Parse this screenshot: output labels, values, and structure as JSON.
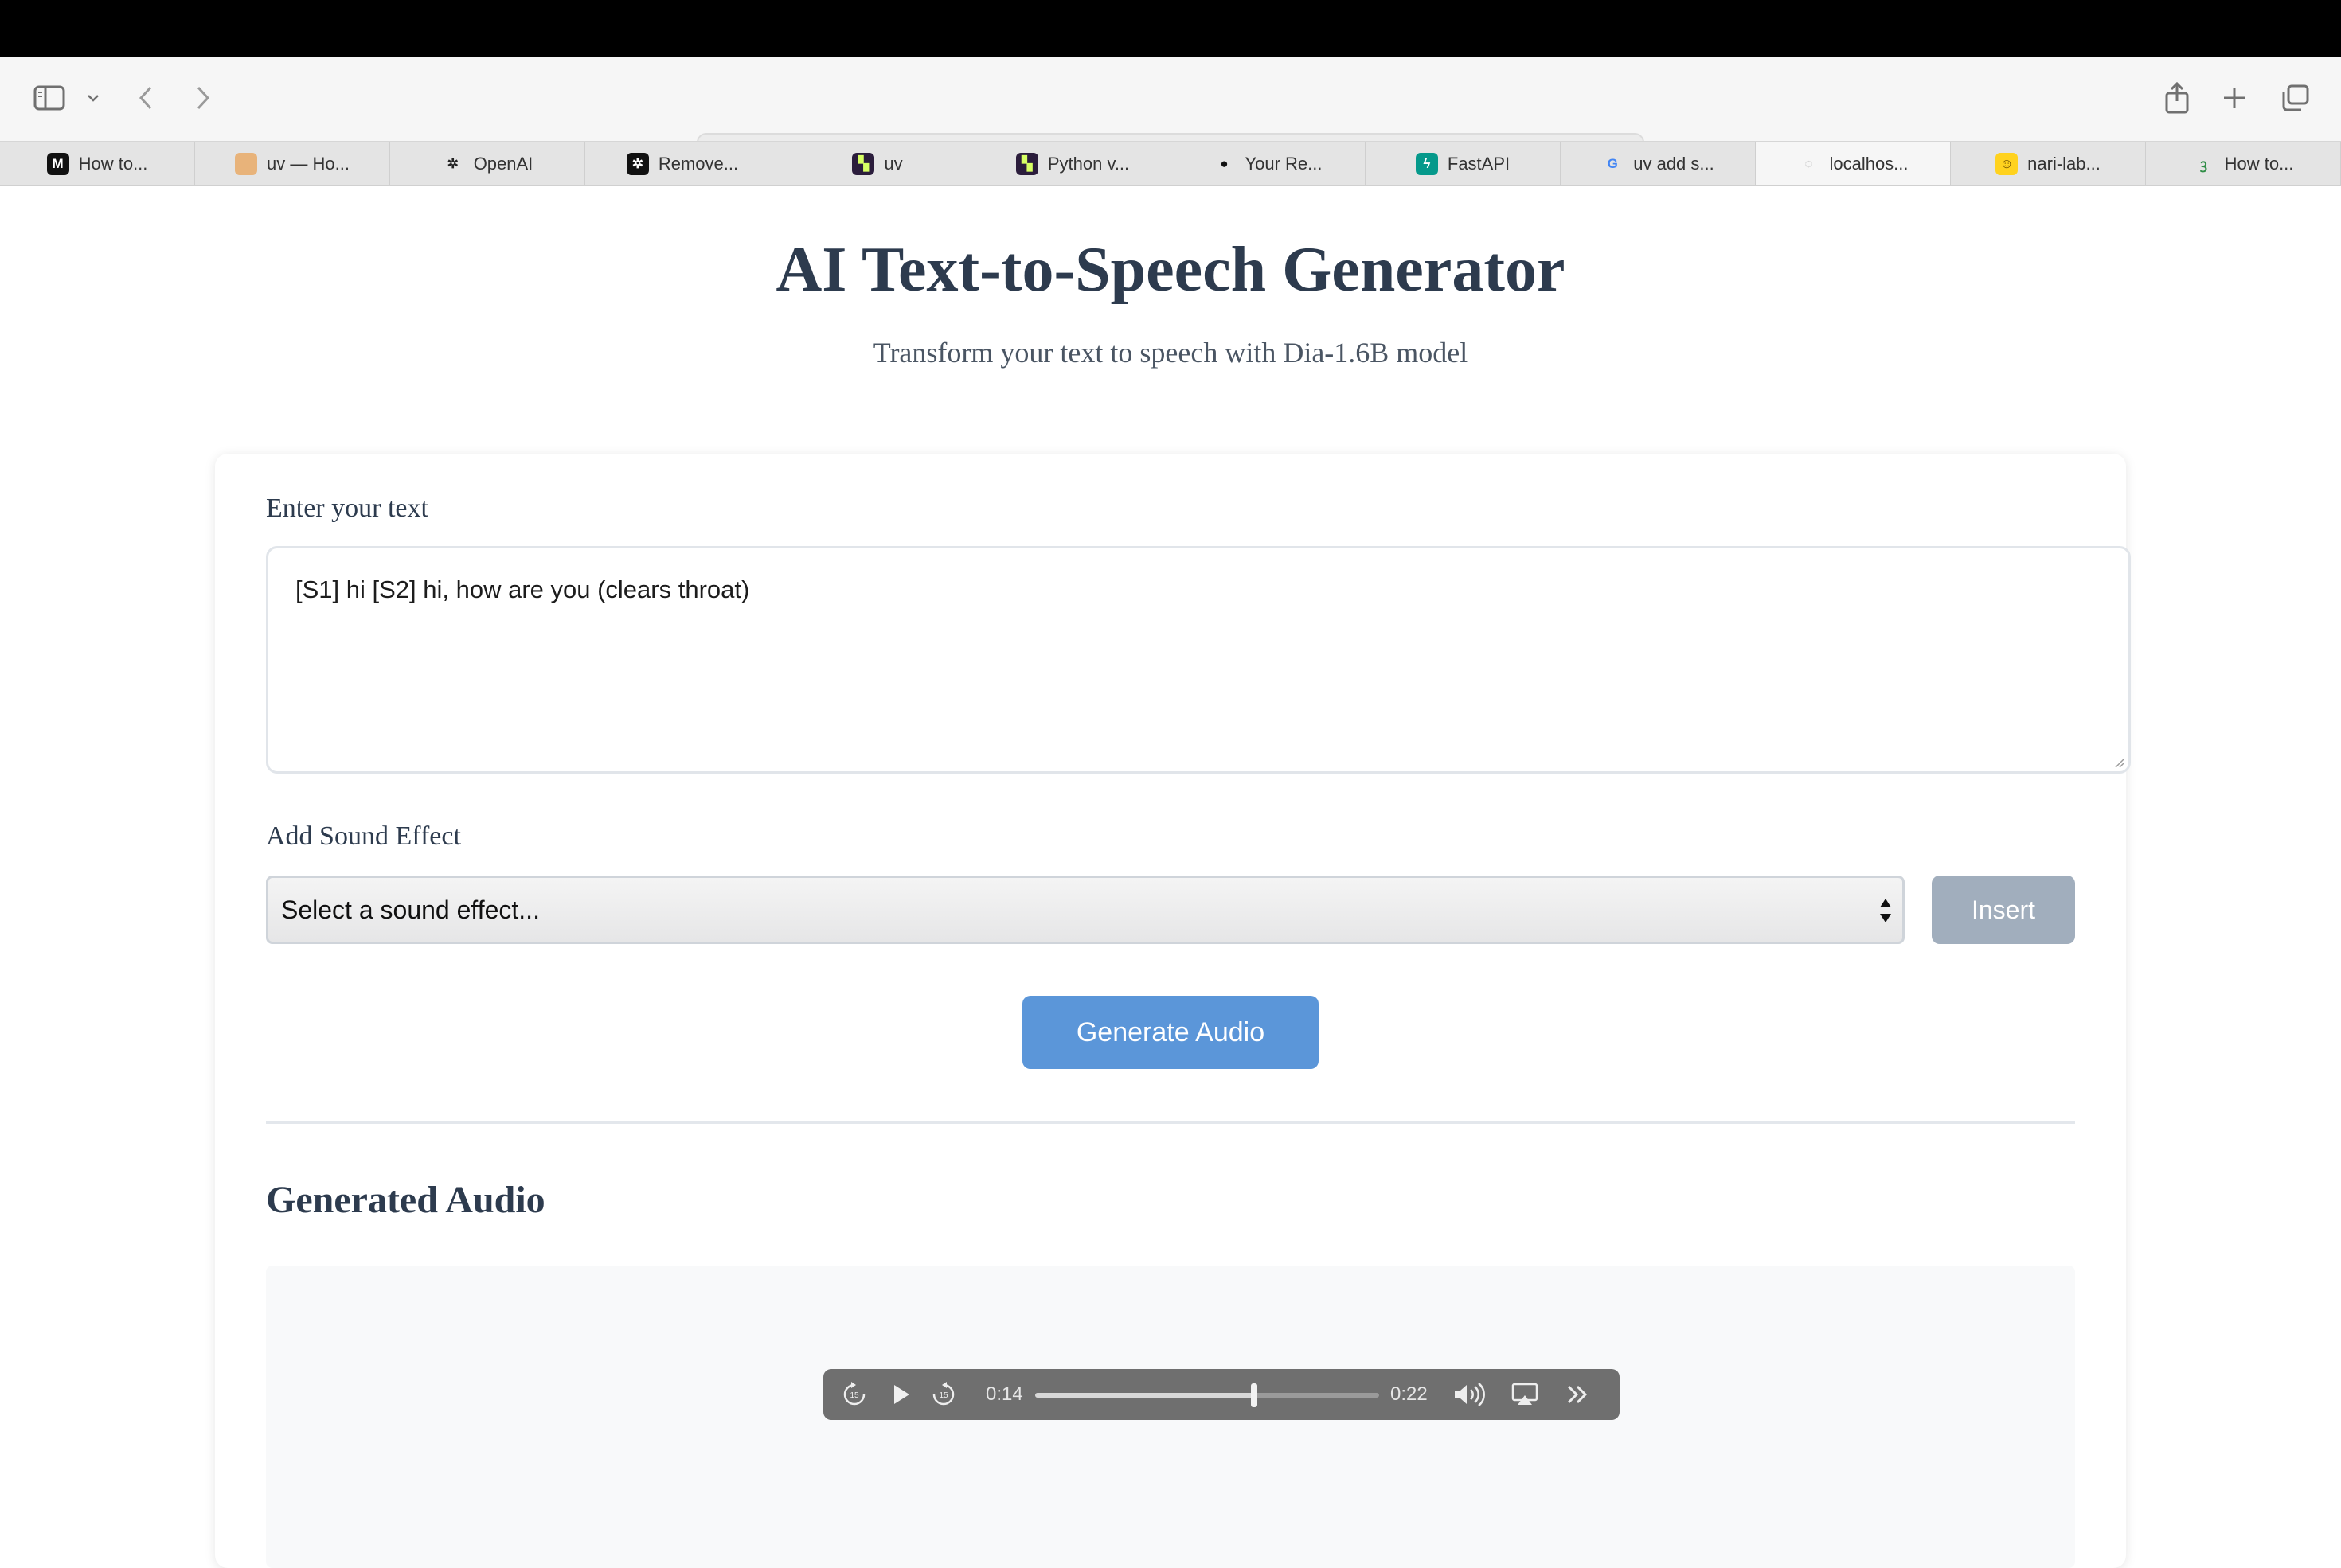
{
  "browser": {
    "url": "localhost",
    "tabs": [
      {
        "label": "How to...",
        "favicon": "medium-icon",
        "favicon_text": "M",
        "favicon_bg": "#111111",
        "favicon_fg": "#ffffff"
      },
      {
        "label": "uv — Ho...",
        "favicon": "jar-icon",
        "favicon_text": "",
        "favicon_bg": "#e8b37a",
        "favicon_fg": "#ffffff"
      },
      {
        "label": "OpenAI",
        "favicon": "openai-icon",
        "favicon_text": "✲",
        "favicon_bg": "#e4e4e4",
        "favicon_fg": "#222222"
      },
      {
        "label": "Remove...",
        "favicon": "openai-dark-icon",
        "favicon_text": "✲",
        "favicon_bg": "#111111",
        "favicon_fg": "#ffffff"
      },
      {
        "label": "uv",
        "favicon": "astral-icon",
        "favicon_text": "▚",
        "favicon_bg": "#2b1d3c",
        "favicon_fg": "#d7ff64"
      },
      {
        "label": "Python v...",
        "favicon": "astral-icon",
        "favicon_text": "▚",
        "favicon_bg": "#2b1d3c",
        "favicon_fg": "#d7ff64"
      },
      {
        "label": "Your Re...",
        "favicon": "github-icon",
        "favicon_text": "●",
        "favicon_bg": "#e4e4e4",
        "favicon_fg": "#111111"
      },
      {
        "label": "FastAPI",
        "favicon": "fastapi-icon",
        "favicon_text": "ϟ",
        "favicon_bg": "#05998b",
        "favicon_fg": "#ffffff"
      },
      {
        "label": "uv add s...",
        "favicon": "google-icon",
        "favicon_text": "G",
        "favicon_bg": "#e4e4e4",
        "favicon_fg": "#4285f4"
      },
      {
        "label": "localhos...",
        "favicon": "globe-icon",
        "favicon_text": "◌",
        "favicon_bg": "#f6f6f6",
        "favicon_fg": "#bbbbbb",
        "active": true
      },
      {
        "label": "nari-lab...",
        "favicon": "huggingface-icon",
        "favicon_text": "☺",
        "favicon_bg": "#ffd21e",
        "favicon_fg": "#6b4b00"
      },
      {
        "label": "How to...",
        "favicon": "geeksforgeeks-icon",
        "favicon_text": "ꝫ",
        "favicon_bg": "#e4e4e4",
        "favicon_fg": "#2f8d46"
      }
    ]
  },
  "page": {
    "title": "AI Text-to-Speech Generator",
    "subtitle": "Transform your text to speech with Dia-1.6B model"
  },
  "form": {
    "text_label": "Enter your text",
    "text_value": "[S1] hi [S2] hi, how are you (clears throat)",
    "sound_label": "Add Sound Effect",
    "sound_selected": "Select a sound effect...",
    "insert_label": "Insert",
    "generate_label": "Generate Audio"
  },
  "output": {
    "heading": "Generated Audio",
    "player": {
      "current_time": "0:14",
      "duration": "0:22",
      "progress": 0.636
    }
  },
  "colors": {
    "heading": "#2d3b4e",
    "generate_button": "#5b96d9",
    "insert_button_disabled": "#a1aebd",
    "player_bg": "#6f6f6f"
  }
}
